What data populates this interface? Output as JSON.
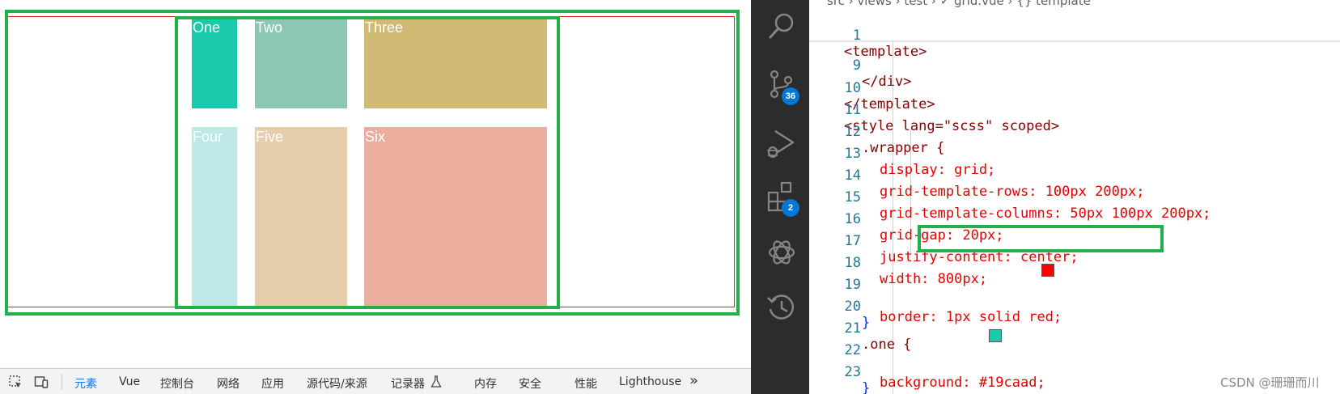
{
  "preview": {
    "cells": [
      {
        "label": "One",
        "color": "#19caad"
      },
      {
        "label": "Two",
        "color": "#8cc7b5"
      },
      {
        "label": "Three",
        "color": "#d1ba74"
      },
      {
        "label": "Four",
        "color": "#bee7e9"
      },
      {
        "label": "Five",
        "color": "#e6ceac"
      },
      {
        "label": "Six",
        "color": "#ecad9e"
      }
    ]
  },
  "devtools": {
    "tabs": [
      "元素",
      "Vue",
      "控制台",
      "网络",
      "应用",
      "源代码/来源",
      "记录器",
      "内存",
      "安全",
      "性能",
      "Lighthouse"
    ],
    "active_tab": "元素",
    "more": "»"
  },
  "activity_bar": {
    "icons": [
      "search-icon",
      "source-control-icon",
      "run-debug-icon",
      "extensions-icon",
      "chatgpt-icon",
      "timeline-icon"
    ],
    "source_control_badge": "36",
    "extensions_badge": "2"
  },
  "editor": {
    "breadcrumb": "src › views › test › ✓ grid.vue › {} template",
    "lines": [
      {
        "n": "1",
        "text": "<template>"
      },
      {
        "n": "9",
        "text": "</div>"
      },
      {
        "n": "10",
        "text": "</template>"
      },
      {
        "n": "11",
        "text": "<style lang=\"scss\" scoped>"
      },
      {
        "n": "12",
        "text": ".wrapper {"
      },
      {
        "n": "13",
        "text": "display: grid;"
      },
      {
        "n": "14",
        "text": "grid-template-rows: 100px 200px;"
      },
      {
        "n": "15",
        "text": "grid-template-columns: 50px 100px 200px;"
      },
      {
        "n": "16",
        "text": "grid-gap: 20px;"
      },
      {
        "n": "17",
        "text": "justify-content: center;"
      },
      {
        "n": "18",
        "text": "width: 800px;"
      },
      {
        "n": "19",
        "text": "border: 1px solid red;"
      },
      {
        "n": "20",
        "text": "}"
      },
      {
        "n": "21",
        "text": ".one {"
      },
      {
        "n": "22",
        "text": "background: #19caad;"
      },
      {
        "n": "23",
        "text": "}"
      }
    ],
    "colors": {
      "red_swatch": "#ff0000",
      "teal_swatch": "#19caad"
    }
  },
  "watermark": "CSDN @珊珊而川"
}
